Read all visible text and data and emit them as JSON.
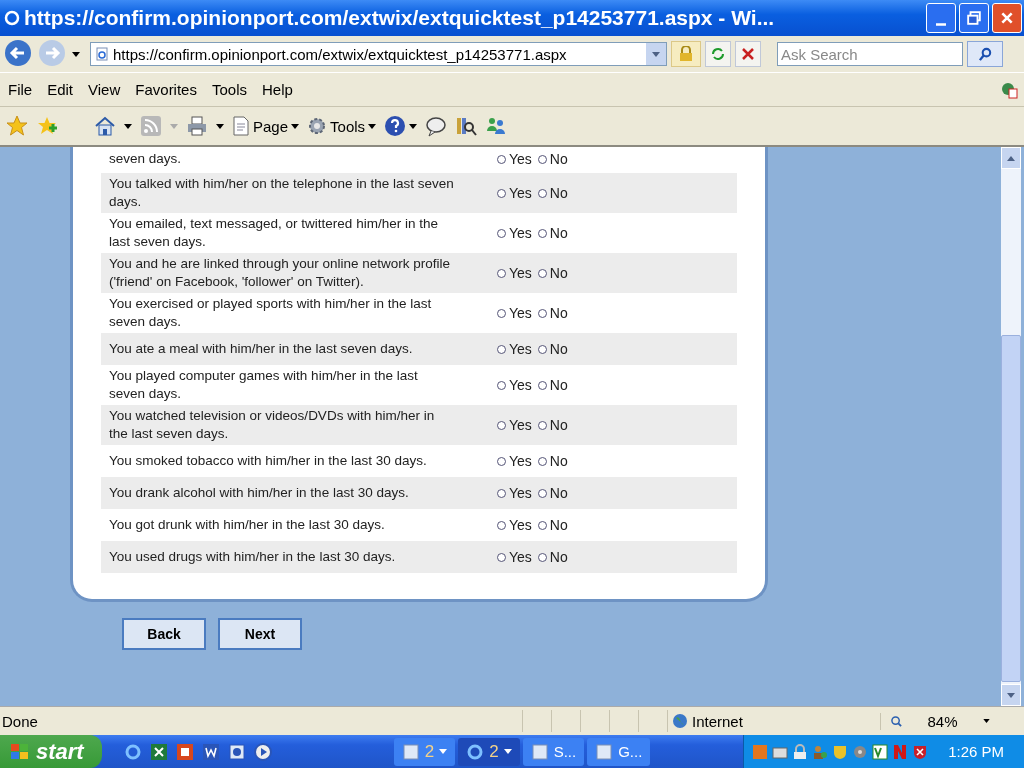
{
  "window": {
    "title": "https://confirm.opinionport.com/extwix/extquicktest_p14253771.aspx - Wi..."
  },
  "address_bar": {
    "url": "https://confirm.opinionport.com/extwix/extquicktest_p14253771.aspx"
  },
  "search": {
    "placeholder": "Ask Search"
  },
  "menu": [
    "File",
    "Edit",
    "View",
    "Favorites",
    "Tools",
    "Help"
  ],
  "toolbar": [
    {
      "label": "Page"
    },
    {
      "label": "Tools"
    }
  ],
  "questions": [
    {
      "text": "seven days.",
      "options": [
        {
          "label": "Yes",
          "selected": false
        },
        {
          "label": "No",
          "selected": false
        }
      ]
    },
    {
      "text": "You talked with him/her on the telephone in the last seven days.",
      "options": [
        {
          "label": "Yes",
          "selected": false
        },
        {
          "label": "No",
          "selected": false
        }
      ]
    },
    {
      "text": "You emailed, text messaged, or twittered him/her in the last seven days.",
      "options": [
        {
          "label": "Yes",
          "selected": false
        },
        {
          "label": "No",
          "selected": false
        }
      ]
    },
    {
      "text": "You and he are linked through your online network profile ('friend' on Facebook, 'follower' on Twitter).",
      "options": [
        {
          "label": "Yes",
          "selected": false
        },
        {
          "label": "No",
          "selected": false
        }
      ]
    },
    {
      "text": "You exercised or played sports with him/her in the last seven days.",
      "options": [
        {
          "label": "Yes",
          "selected": false
        },
        {
          "label": "No",
          "selected": false
        }
      ]
    },
    {
      "text": "You ate a meal with him/her in the last seven days.",
      "options": [
        {
          "label": "Yes",
          "selected": false
        },
        {
          "label": "No",
          "selected": false
        }
      ]
    },
    {
      "text": "You played computer games with him/her in the last seven days.",
      "options": [
        {
          "label": "Yes",
          "selected": false
        },
        {
          "label": "No",
          "selected": false
        }
      ]
    },
    {
      "text": "You watched television or videos/DVDs with him/her in the last seven days.",
      "options": [
        {
          "label": "Yes",
          "selected": false
        },
        {
          "label": "No",
          "selected": false
        }
      ]
    },
    {
      "text": "You smoked tobacco with him/her in the last 30 days.",
      "options": [
        {
          "label": "Yes",
          "selected": false
        },
        {
          "label": "No",
          "selected": false
        }
      ]
    },
    {
      "text": "You drank alcohol with him/her in the last 30 days.",
      "options": [
        {
          "label": "Yes",
          "selected": false
        },
        {
          "label": "No",
          "selected": false
        }
      ]
    },
    {
      "text": "You got drunk with him/her in the last 30 days.",
      "options": [
        {
          "label": "Yes",
          "selected": false
        },
        {
          "label": "No",
          "selected": false
        }
      ]
    },
    {
      "text": "You used drugs with him/her in the last 30 days.",
      "options": [
        {
          "label": "Yes",
          "selected": false
        },
        {
          "label": "No",
          "selected": false
        }
      ]
    }
  ],
  "buttons": [
    "Back",
    "Next"
  ],
  "status_bar": {
    "text": "Done",
    "zone": "Internet",
    "zoom": "84%"
  },
  "taskbar": {
    "start": "start",
    "groups": [
      {
        "label": "2"
      },
      {
        "label": "2"
      },
      {
        "label": "S..."
      },
      {
        "label": "G..."
      }
    ],
    "clock": "1:26 PM"
  }
}
